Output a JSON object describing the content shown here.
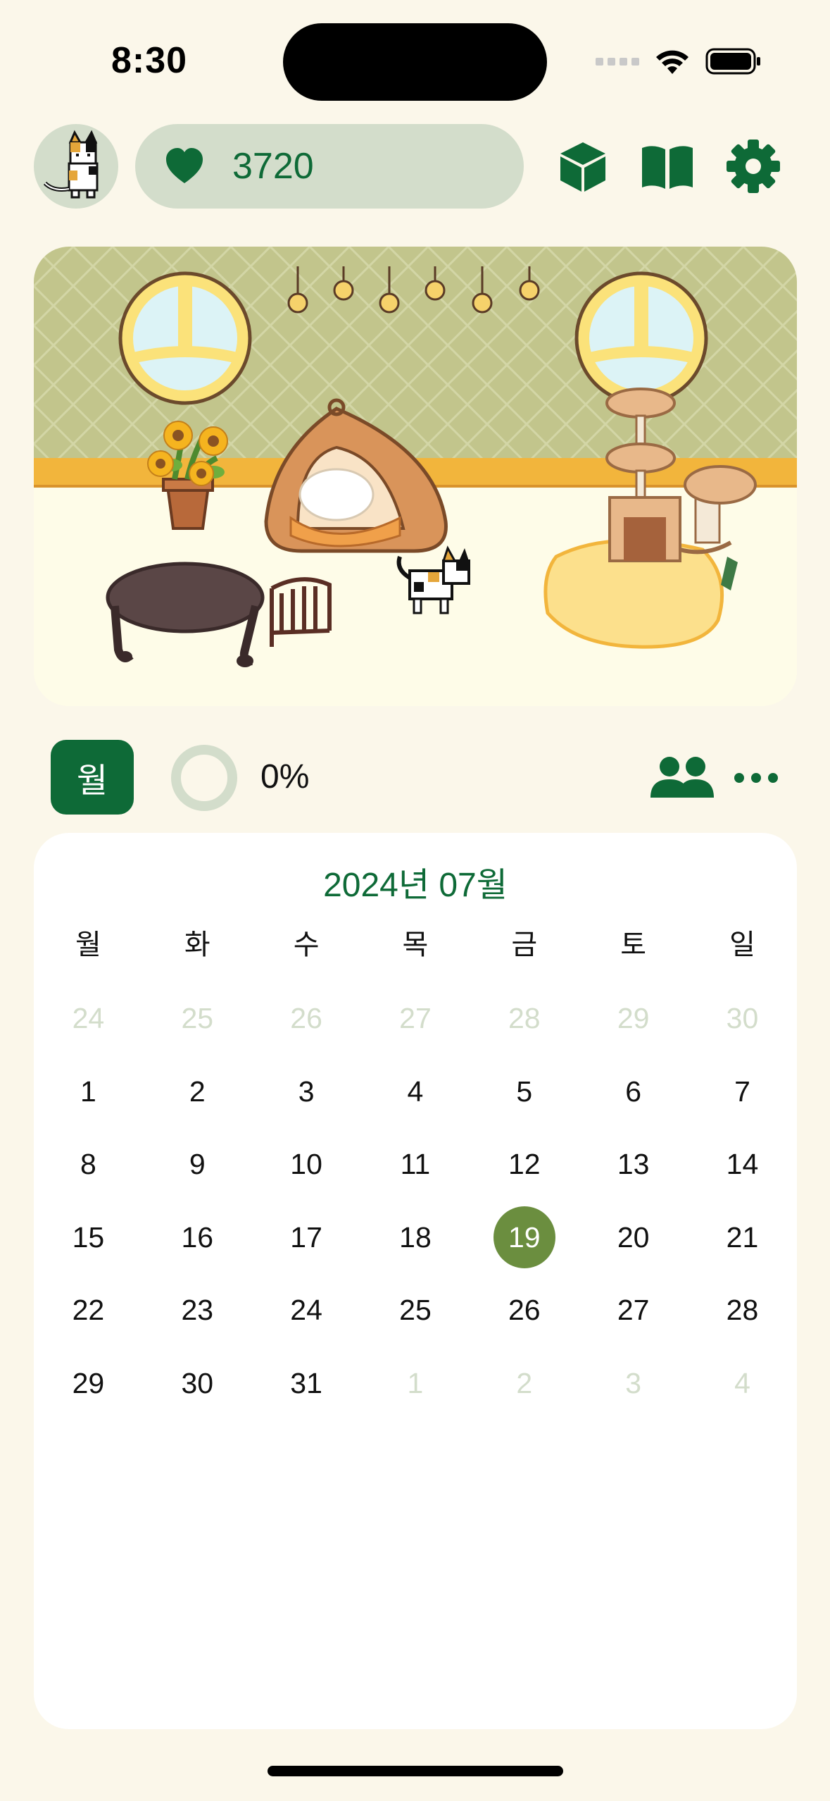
{
  "status_bar": {
    "time": "8:30"
  },
  "header": {
    "avatar_icon": "calico-cat-avatar",
    "score_icon": "heart-icon",
    "score": "3720",
    "icons": [
      "inventory-cube-icon",
      "book-icon",
      "gear-icon"
    ]
  },
  "toolbar": {
    "view_toggle_label": "월",
    "progress": 0,
    "progress_label": "0%",
    "friends_icon": "friends-icon",
    "more_icon": "more-icon"
  },
  "calendar": {
    "title": "2024년 07월",
    "weekdays": [
      "월",
      "화",
      "수",
      "목",
      "금",
      "토",
      "일"
    ],
    "weeks": [
      [
        "24",
        "25",
        "26",
        "27",
        "28",
        "29",
        "30"
      ],
      [
        "1",
        "2",
        "3",
        "4",
        "5",
        "6",
        "7"
      ],
      [
        "8",
        "9",
        "10",
        "11",
        "12",
        "13",
        "14"
      ],
      [
        "15",
        "16",
        "17",
        "18",
        "19",
        "20",
        "21"
      ],
      [
        "22",
        "23",
        "24",
        "25",
        "26",
        "27",
        "28"
      ],
      [
        "29",
        "30",
        "31",
        "1",
        "2",
        "3",
        "4"
      ]
    ],
    "selected_day": "19"
  },
  "colors": {
    "accent": "#0E6A37",
    "pill": "#D3DDCB",
    "selected": "#6B8E3F",
    "background": "#FBF7EA"
  }
}
